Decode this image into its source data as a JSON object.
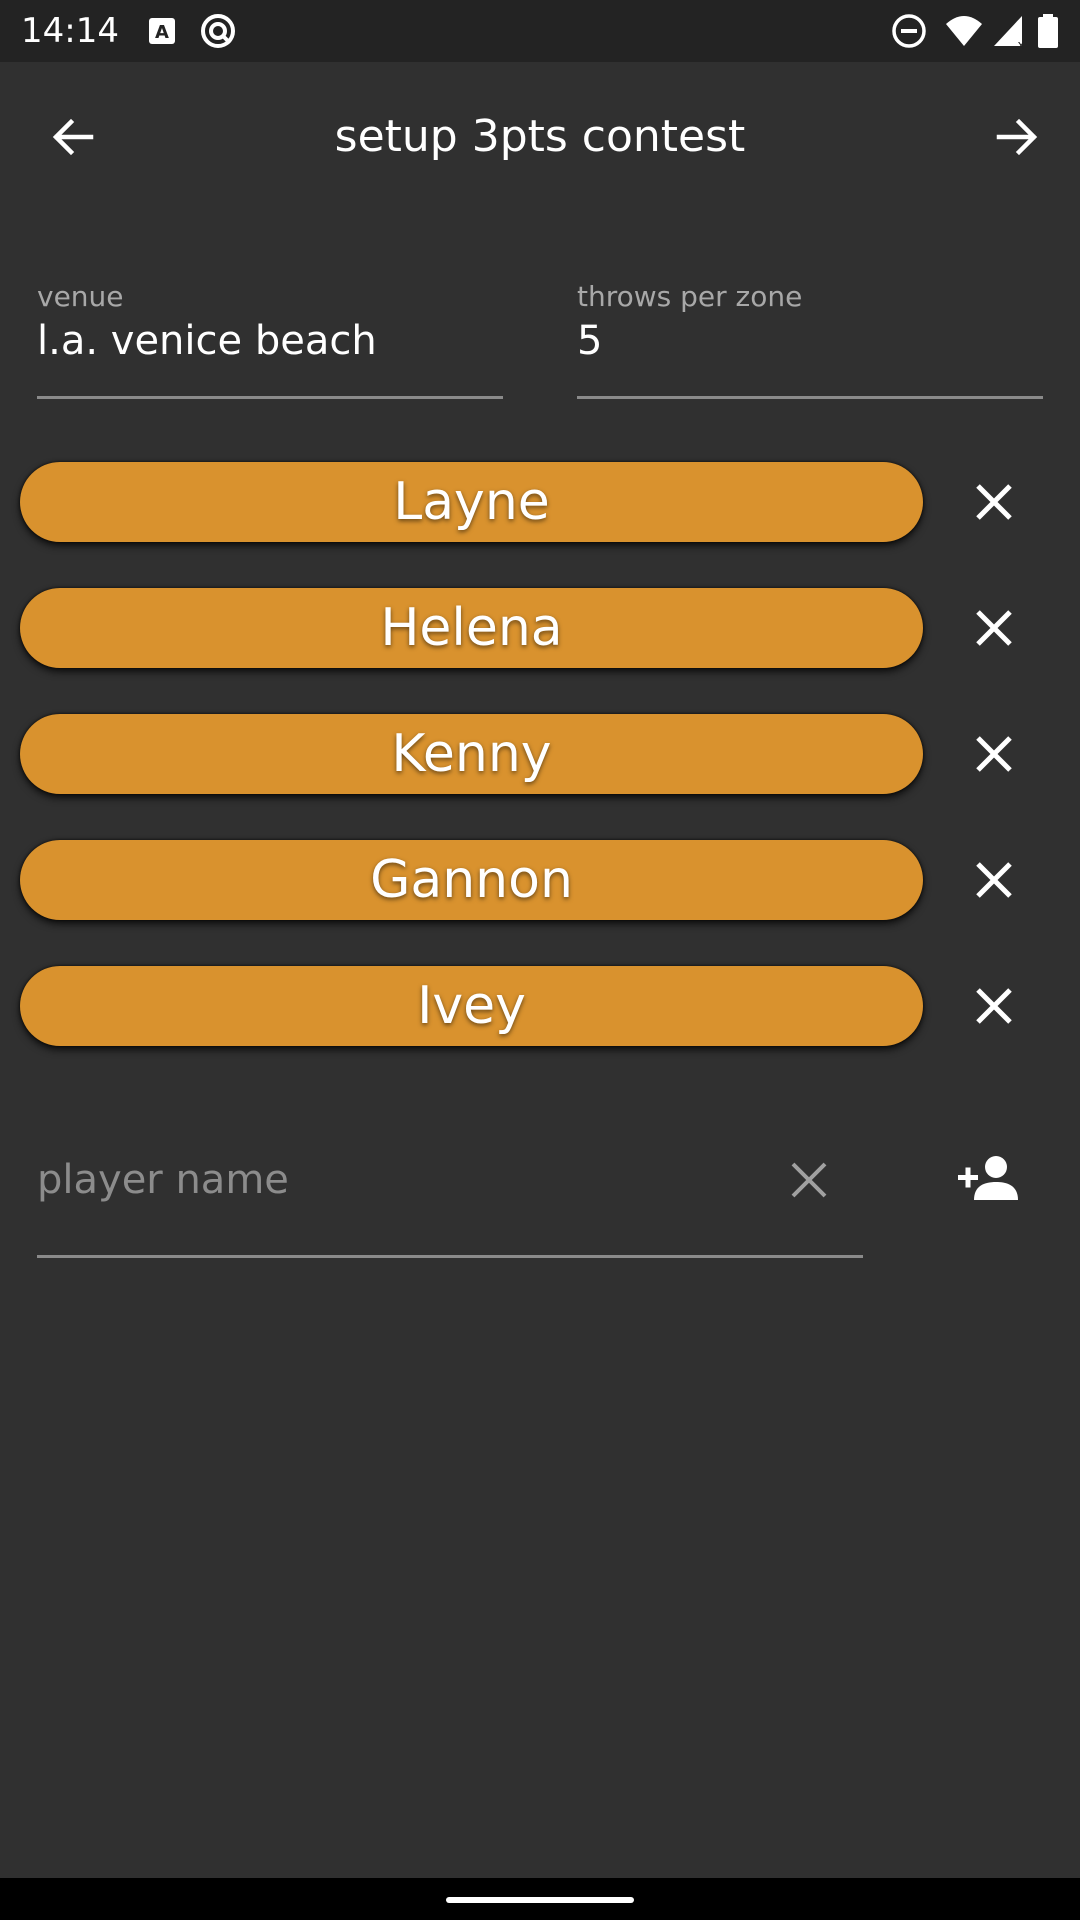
{
  "status_bar": {
    "time": "14:14",
    "icons": [
      "accessibility-a-icon",
      "sync-circle-icon",
      "do-not-disturb-icon",
      "wifi-icon",
      "cell-signal-icon",
      "battery-icon"
    ]
  },
  "app_bar": {
    "title": "setup 3pts contest",
    "back_icon": "arrow-left-icon",
    "next_icon": "arrow-right-icon"
  },
  "venue": {
    "label": "venue",
    "value": "l.a. venice beach"
  },
  "throws": {
    "label": "throws per zone",
    "value": "5"
  },
  "players": [
    {
      "name": "Layne"
    },
    {
      "name": "Helena"
    },
    {
      "name": "Kenny"
    },
    {
      "name": "Gannon"
    },
    {
      "name": "Ivey"
    }
  ],
  "new_player": {
    "placeholder": "player name",
    "value": "",
    "clear_icon": "close-icon",
    "add_icon": "person-add-icon"
  },
  "colors": {
    "background": "#303030",
    "status_bar": "#232323",
    "pill": "#d9922e",
    "underline": "#8a8a8a"
  }
}
